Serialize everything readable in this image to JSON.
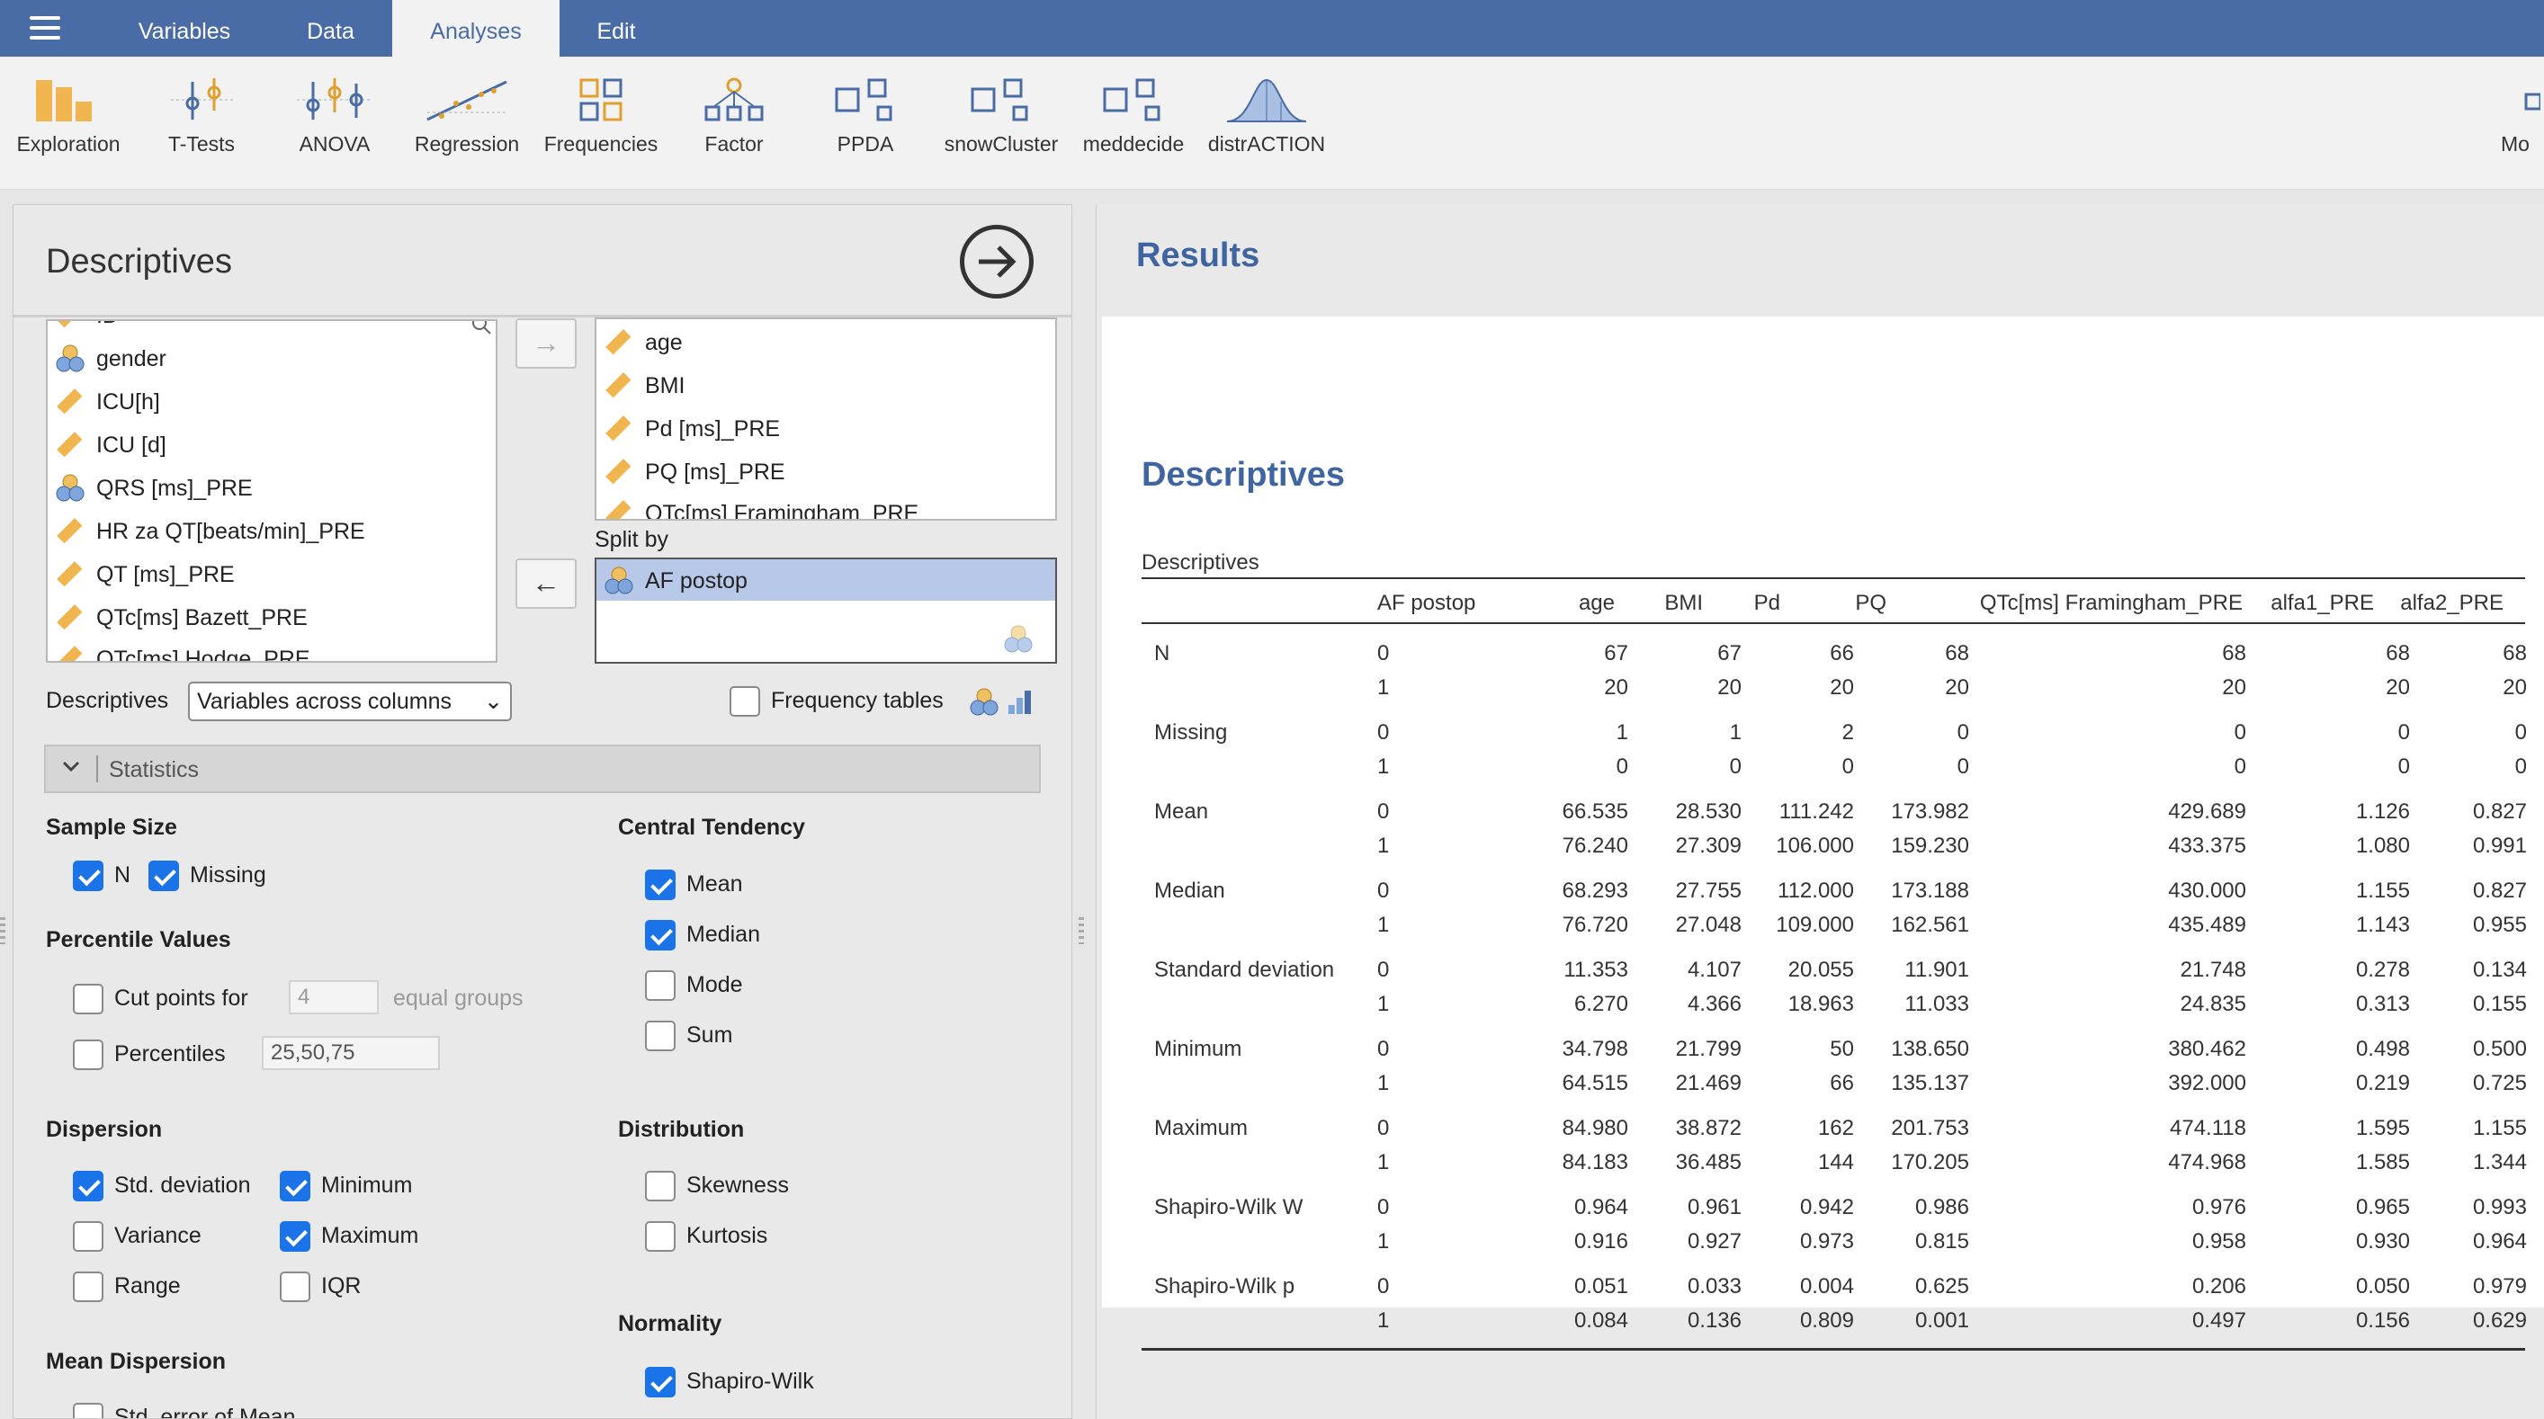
{
  "topbar": {
    "tabs": [
      {
        "label": "Variables"
      },
      {
        "label": "Data"
      },
      {
        "label": "Analyses"
      },
      {
        "label": "Edit"
      }
    ]
  },
  "ribbon": {
    "items": [
      {
        "label": "Exploration",
        "icon": "exploration-icon"
      },
      {
        "label": "T-Tests",
        "icon": "t-tests-icon"
      },
      {
        "label": "ANOVA",
        "icon": "anova-icon"
      },
      {
        "label": "Regression",
        "icon": "regression-icon"
      },
      {
        "label": "Frequencies",
        "icon": "frequencies-icon"
      },
      {
        "label": "Factor",
        "icon": "factor-icon"
      },
      {
        "label": "PPDA",
        "icon": "module-icon"
      },
      {
        "label": "snowCluster",
        "icon": "module-icon"
      },
      {
        "label": "meddecide",
        "icon": "module-icon"
      },
      {
        "label": "distrACTION",
        "icon": "distribution-icon"
      },
      {
        "label": "Mo",
        "icon": "modules-icon"
      }
    ]
  },
  "analysis": {
    "title": "Descriptives",
    "available_vars": [
      {
        "name": "ID",
        "type": "continuous"
      },
      {
        "name": "gender",
        "type": "nominal"
      },
      {
        "name": "ICU[h]",
        "type": "continuous"
      },
      {
        "name": "ICU [d]",
        "type": "continuous"
      },
      {
        "name": "QRS [ms]_PRE",
        "type": "nominal"
      },
      {
        "name": "HR za QT[beats/min]_PRE",
        "type": "continuous"
      },
      {
        "name": "QT [ms]_PRE",
        "type": "continuous"
      },
      {
        "name": "QTc[ms] Bazett_PRE",
        "type": "continuous"
      },
      {
        "name": "QTc[ms] Hodge_PRE",
        "type": "continuous"
      }
    ],
    "selected_vars": [
      {
        "name": "age"
      },
      {
        "name": "BMI"
      },
      {
        "name": "Pd [ms]_PRE"
      },
      {
        "name": "PQ [ms]_PRE"
      },
      {
        "name": "QTc[ms] Framingham_PRE"
      }
    ],
    "split_by_label": "Split by",
    "split_by_vars": [
      {
        "name": "AF postop"
      }
    ],
    "descriptives_label": "Descriptives",
    "descriptives_option": "Variables across columns",
    "frequency_tables_label": "Frequency tables",
    "frequency_tables_checked": false,
    "statistics_header": "Statistics",
    "sections": {
      "sample_size": {
        "title": "Sample Size",
        "n": {
          "label": "N",
          "checked": true
        },
        "missing": {
          "label": "Missing",
          "checked": true
        }
      },
      "percentile_values": {
        "title": "Percentile Values",
        "cut_points": {
          "label": "Cut points for",
          "checked": false,
          "value": "4",
          "suffix": "equal groups"
        },
        "percentiles": {
          "label": "Percentiles",
          "checked": false,
          "value": "25,50,75"
        }
      },
      "dispersion": {
        "title": "Dispersion",
        "std_dev": {
          "label": "Std. deviation",
          "checked": true
        },
        "minimum": {
          "label": "Minimum",
          "checked": true
        },
        "variance": {
          "label": "Variance",
          "checked": false
        },
        "maximum": {
          "label": "Maximum",
          "checked": true
        },
        "range": {
          "label": "Range",
          "checked": false
        },
        "iqr": {
          "label": "IQR",
          "checked": false
        }
      },
      "mean_dispersion": {
        "title": "Mean Dispersion",
        "se_mean": {
          "label": "Std. error of Mean",
          "checked": false
        }
      },
      "central_tendency": {
        "title": "Central Tendency",
        "mean": {
          "label": "Mean",
          "checked": true
        },
        "median": {
          "label": "Median",
          "checked": true
        },
        "mode": {
          "label": "Mode",
          "checked": false
        },
        "sum": {
          "label": "Sum",
          "checked": false
        }
      },
      "distribution": {
        "title": "Distribution",
        "skewness": {
          "label": "Skewness",
          "checked": false
        },
        "kurtosis": {
          "label": "Kurtosis",
          "checked": false
        }
      },
      "normality": {
        "title": "Normality",
        "shapiro_wilk": {
          "label": "Shapiro-Wilk",
          "checked": true
        }
      }
    }
  },
  "results": {
    "title": "Results",
    "subtitle": "Descriptives",
    "table": {
      "caption": "Descriptives",
      "columns": [
        "AF postop",
        "age",
        "BMI",
        "Pd",
        "PQ",
        "QTc[ms] Framingham_PRE",
        "alfa1_PRE",
        "alfa2_PRE"
      ],
      "rows": [
        {
          "stat": "N",
          "groups": [
            {
              "g": "0",
              "v": [
                "67",
                "67",
                "66",
                "68",
                "68",
                "68",
                "68"
              ]
            },
            {
              "g": "1",
              "v": [
                "20",
                "20",
                "20",
                "20",
                "20",
                "20",
                "20"
              ]
            }
          ]
        },
        {
          "stat": "Missing",
          "groups": [
            {
              "g": "0",
              "v": [
                "1",
                "1",
                "2",
                "0",
                "0",
                "0",
                "0"
              ]
            },
            {
              "g": "1",
              "v": [
                "0",
                "0",
                "0",
                "0",
                "0",
                "0",
                "0"
              ]
            }
          ]
        },
        {
          "stat": "Mean",
          "groups": [
            {
              "g": "0",
              "v": [
                "66.535",
                "28.530",
                "111.242",
                "173.982",
                "429.689",
                "1.126",
                "0.827"
              ]
            },
            {
              "g": "1",
              "v": [
                "76.240",
                "27.309",
                "106.000",
                "159.230",
                "433.375",
                "1.080",
                "0.991"
              ]
            }
          ]
        },
        {
          "stat": "Median",
          "groups": [
            {
              "g": "0",
              "v": [
                "68.293",
                "27.755",
                "112.000",
                "173.188",
                "430.000",
                "1.155",
                "0.827"
              ]
            },
            {
              "g": "1",
              "v": [
                "76.720",
                "27.048",
                "109.000",
                "162.561",
                "435.489",
                "1.143",
                "0.955"
              ]
            }
          ]
        },
        {
          "stat": "Standard deviation",
          "groups": [
            {
              "g": "0",
              "v": [
                "11.353",
                "4.107",
                "20.055",
                "11.901",
                "21.748",
                "0.278",
                "0.134"
              ]
            },
            {
              "g": "1",
              "v": [
                "6.270",
                "4.366",
                "18.963",
                "11.033",
                "24.835",
                "0.313",
                "0.155"
              ]
            }
          ]
        },
        {
          "stat": "Minimum",
          "groups": [
            {
              "g": "0",
              "v": [
                "34.798",
                "21.799",
                "50",
                "138.650",
                "380.462",
                "0.498",
                "0.500"
              ]
            },
            {
              "g": "1",
              "v": [
                "64.515",
                "21.469",
                "66",
                "135.137",
                "392.000",
                "0.219",
                "0.725"
              ]
            }
          ]
        },
        {
          "stat": "Maximum",
          "groups": [
            {
              "g": "0",
              "v": [
                "84.980",
                "38.872",
                "162",
                "201.753",
                "474.118",
                "1.595",
                "1.155"
              ]
            },
            {
              "g": "1",
              "v": [
                "84.183",
                "36.485",
                "144",
                "170.205",
                "474.968",
                "1.585",
                "1.344"
              ]
            }
          ]
        },
        {
          "stat": "Shapiro-Wilk W",
          "groups": [
            {
              "g": "0",
              "v": [
                "0.964",
                "0.961",
                "0.942",
                "0.986",
                "0.976",
                "0.965",
                "0.993"
              ]
            },
            {
              "g": "1",
              "v": [
                "0.916",
                "0.927",
                "0.973",
                "0.815",
                "0.958",
                "0.930",
                "0.964"
              ]
            }
          ]
        },
        {
          "stat": "Shapiro-Wilk p",
          "groups": [
            {
              "g": "0",
              "v": [
                "0.051",
                "0.033",
                "0.004",
                "0.625",
                "0.206",
                "0.050",
                "0.979"
              ]
            },
            {
              "g": "1",
              "v": [
                "0.084",
                "0.136",
                "0.809",
                "0.001",
                "0.497",
                "0.156",
                "0.629"
              ]
            }
          ]
        }
      ]
    }
  },
  "colors": {
    "topbar": "#4a6ca6",
    "accent_blue": "#3f65a0",
    "checkbox_blue": "#1a73e8",
    "ordinal_ruler": "#e0a030",
    "selection": "#b8c8e8"
  }
}
